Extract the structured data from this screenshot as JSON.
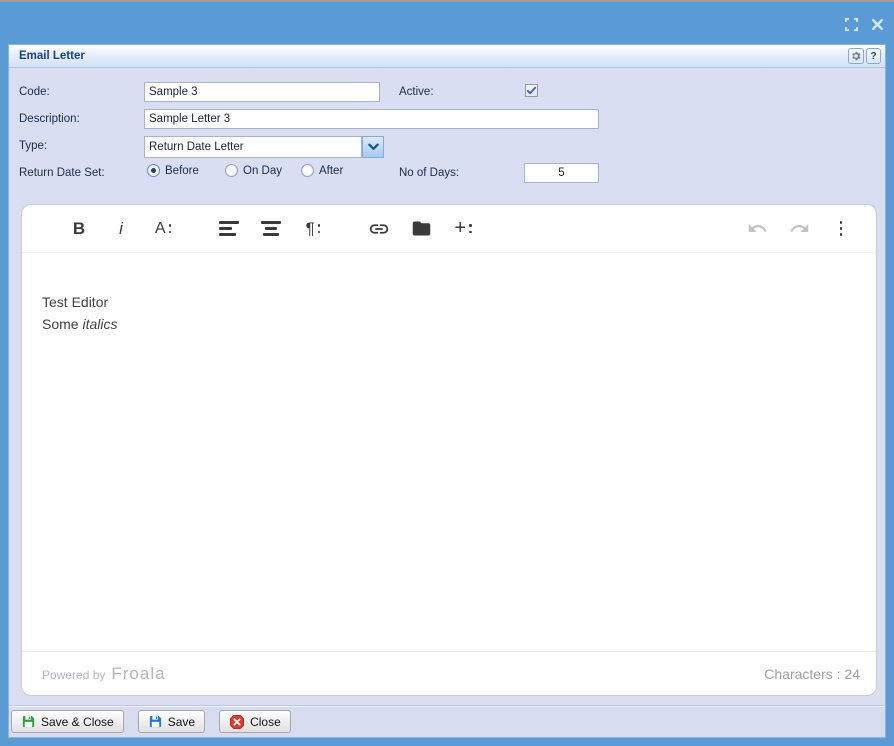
{
  "panel": {
    "title": "Email Letter",
    "help_label": "?"
  },
  "form": {
    "code_label": "Code:",
    "code_value": "Sample 3",
    "active_label": "Active:",
    "active_checked": true,
    "description_label": "Description:",
    "description_value": "Sample Letter 3",
    "type_label": "Type:",
    "type_value": "Return Date Letter",
    "return_date_set_label": "Return Date Set:",
    "radio_options": [
      {
        "label": "Before",
        "selected": true
      },
      {
        "label": "On Day",
        "selected": false
      },
      {
        "label": "After",
        "selected": false
      }
    ],
    "no_of_days_label": "No of Days:",
    "no_of_days_value": "5"
  },
  "editor": {
    "bold_label": "B",
    "italic_label": "i",
    "font_label": "A",
    "paragraph_label": "¶",
    "plus_label": "+",
    "line1": "Test Editor",
    "line2_text": "Some ",
    "line2_italic": "italics",
    "powered_by": "Powered by",
    "brand": "Froala",
    "char_count": "Characters : 24"
  },
  "footer": {
    "buttons": [
      {
        "label": "Save & Close"
      },
      {
        "label": "Save"
      },
      {
        "label": "Close"
      }
    ]
  },
  "colors": {
    "titlebar_blue": "#5b9bd5",
    "panel_bg": "#d9def2",
    "header_text": "#15428b",
    "save_close_green": "#2e9e4e",
    "save_blue": "#1e7ad2",
    "close_red": "#dd3b2f"
  }
}
